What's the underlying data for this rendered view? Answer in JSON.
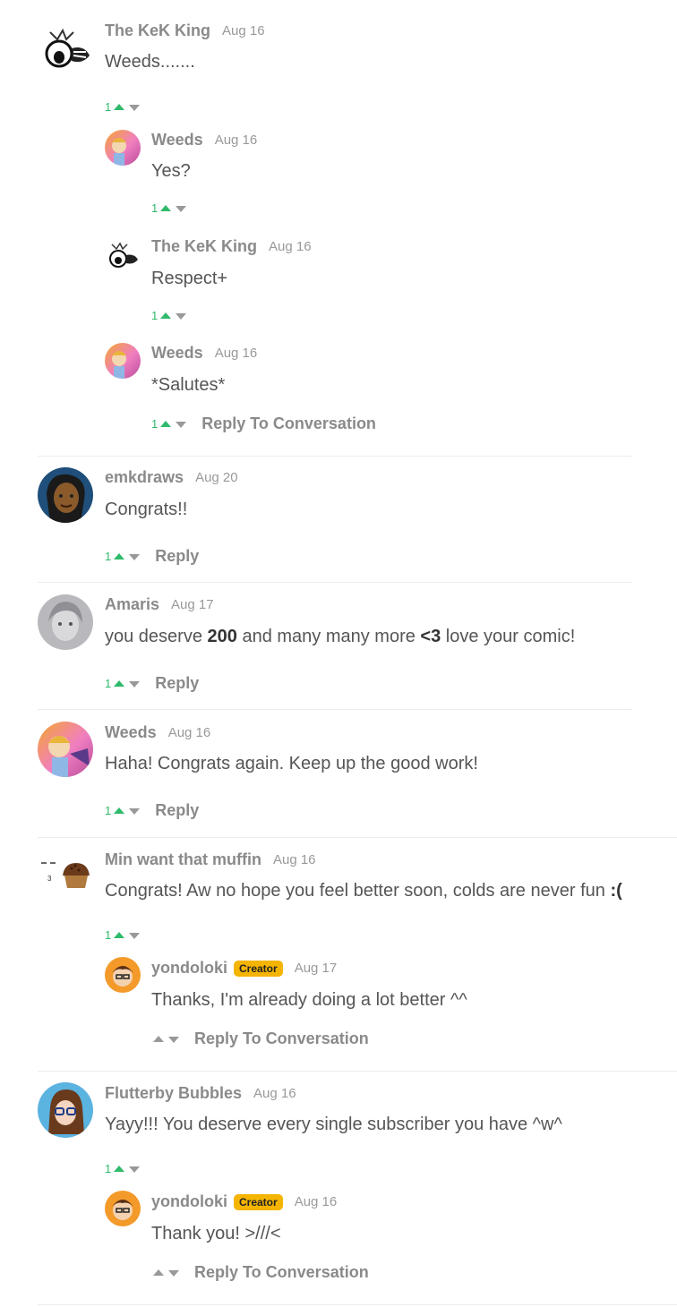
{
  "comments": [
    {
      "user": "The KeK King",
      "date": "Aug 16",
      "text": "Weeds.......",
      "votes": "1"
    },
    {
      "user": "Weeds",
      "date": "Aug 16",
      "text": "Yes?",
      "votes": "1"
    },
    {
      "user": "The KeK King",
      "date": "Aug 16",
      "text": "Respect+",
      "votes": "1"
    },
    {
      "user": "Weeds",
      "date": "Aug 16",
      "text": "*Salutes*",
      "votes": "1",
      "reply": "Reply To Conversation"
    },
    {
      "user": "emkdraws",
      "date": "Aug 20",
      "text": "Congrats!!",
      "votes": "1",
      "reply": "Reply"
    },
    {
      "user": "Amaris",
      "date": "Aug 17",
      "text_a": "you deserve ",
      "text_b": "200",
      "text_c": " and many many more ",
      "text_d": "<3",
      "text_e": " love your comic!",
      "votes": "1",
      "reply": "Reply"
    },
    {
      "user": "Weeds",
      "date": "Aug 16",
      "text": "Haha! Congrats again. Keep up the good work!",
      "votes": "1",
      "reply": "Reply"
    },
    {
      "user": "Min want that muffin",
      "date": "Aug 16",
      "text_a": "Congrats! Aw no hope you feel better soon, colds are never fun ",
      "text_b": ":(",
      "votes": "1"
    },
    {
      "user": "yondoloki",
      "badge": "Creator",
      "date": "Aug 17",
      "text": "Thanks, I'm already doing a lot better ^^",
      "reply": "Reply To Conversation"
    },
    {
      "user": "Flutterby Bubbles",
      "date": "Aug 16",
      "text": "Yayy!!! You deserve every single subscriber you have ^w^",
      "votes": "1"
    },
    {
      "user": "yondoloki",
      "badge": "Creator",
      "date": "Aug 16",
      "text": "Thank you! >///<",
      "reply": "Reply To Conversation"
    }
  ],
  "avatar_icon": "muffin-icon"
}
